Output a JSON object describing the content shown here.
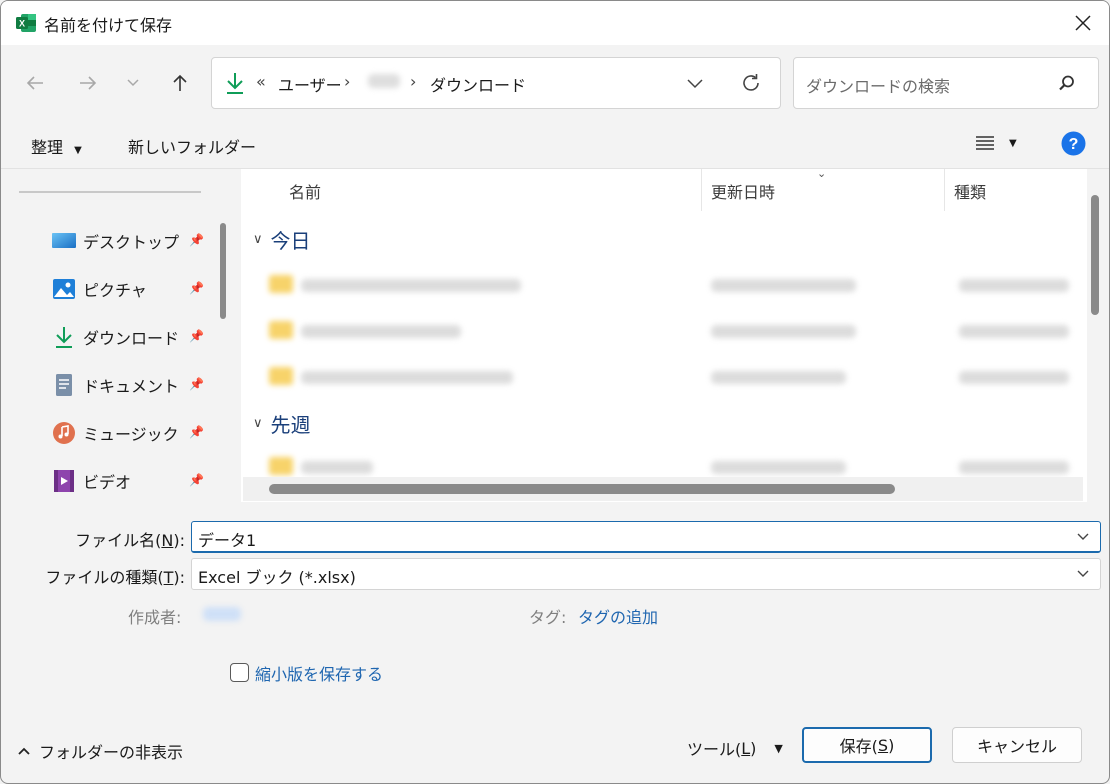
{
  "window": {
    "title": "名前を付けて保存",
    "app_icon": "excel-icon"
  },
  "nav": {
    "breadcrumb": [
      {
        "label": "«"
      },
      {
        "label": "ユーザー"
      },
      {
        "label": "ダウンロード"
      }
    ],
    "search_placeholder": "ダウンロードの検索"
  },
  "commands": {
    "organize": "整理",
    "new_folder": "新しいフォルダー"
  },
  "sidebar": {
    "items": [
      {
        "label": "デスクトップ",
        "icon": "desktop-icon"
      },
      {
        "label": "ピクチャ",
        "icon": "pictures-icon"
      },
      {
        "label": "ダウンロード",
        "icon": "download-icon"
      },
      {
        "label": "ドキュメント",
        "icon": "documents-icon"
      },
      {
        "label": "ミュージック",
        "icon": "music-icon"
      },
      {
        "label": "ビデオ",
        "icon": "videos-icon"
      }
    ]
  },
  "filelist": {
    "columns": [
      "名前",
      "更新日時",
      "種類"
    ],
    "groups": [
      {
        "label": "今日"
      },
      {
        "label": "先週"
      }
    ]
  },
  "form": {
    "filename_label": "ファイル名(",
    "filename_key": "N",
    "filename_label_end": "):",
    "filename_value": "データ1",
    "filetype_label": "ファイルの種類(",
    "filetype_key": "T",
    "filetype_label_end": "):",
    "filetype_value": "Excel ブック (*.xlsx)",
    "author_label": "作成者:",
    "tags_label": "タグ:",
    "tags_link": "タグの追加",
    "thumbnail_label": "縮小版を保存する"
  },
  "footer": {
    "hide_folders": "フォルダーの非表示",
    "tools": "ツール(",
    "tools_key": "L",
    "tools_end": ")",
    "save": "保存(",
    "save_key": "S",
    "save_end": ")",
    "cancel": "キャンセル"
  },
  "colors": {
    "accent": "#1b6aad",
    "link": "#1f66b0",
    "group_heading": "#1a3f7a",
    "excel_green": "#107c41"
  }
}
